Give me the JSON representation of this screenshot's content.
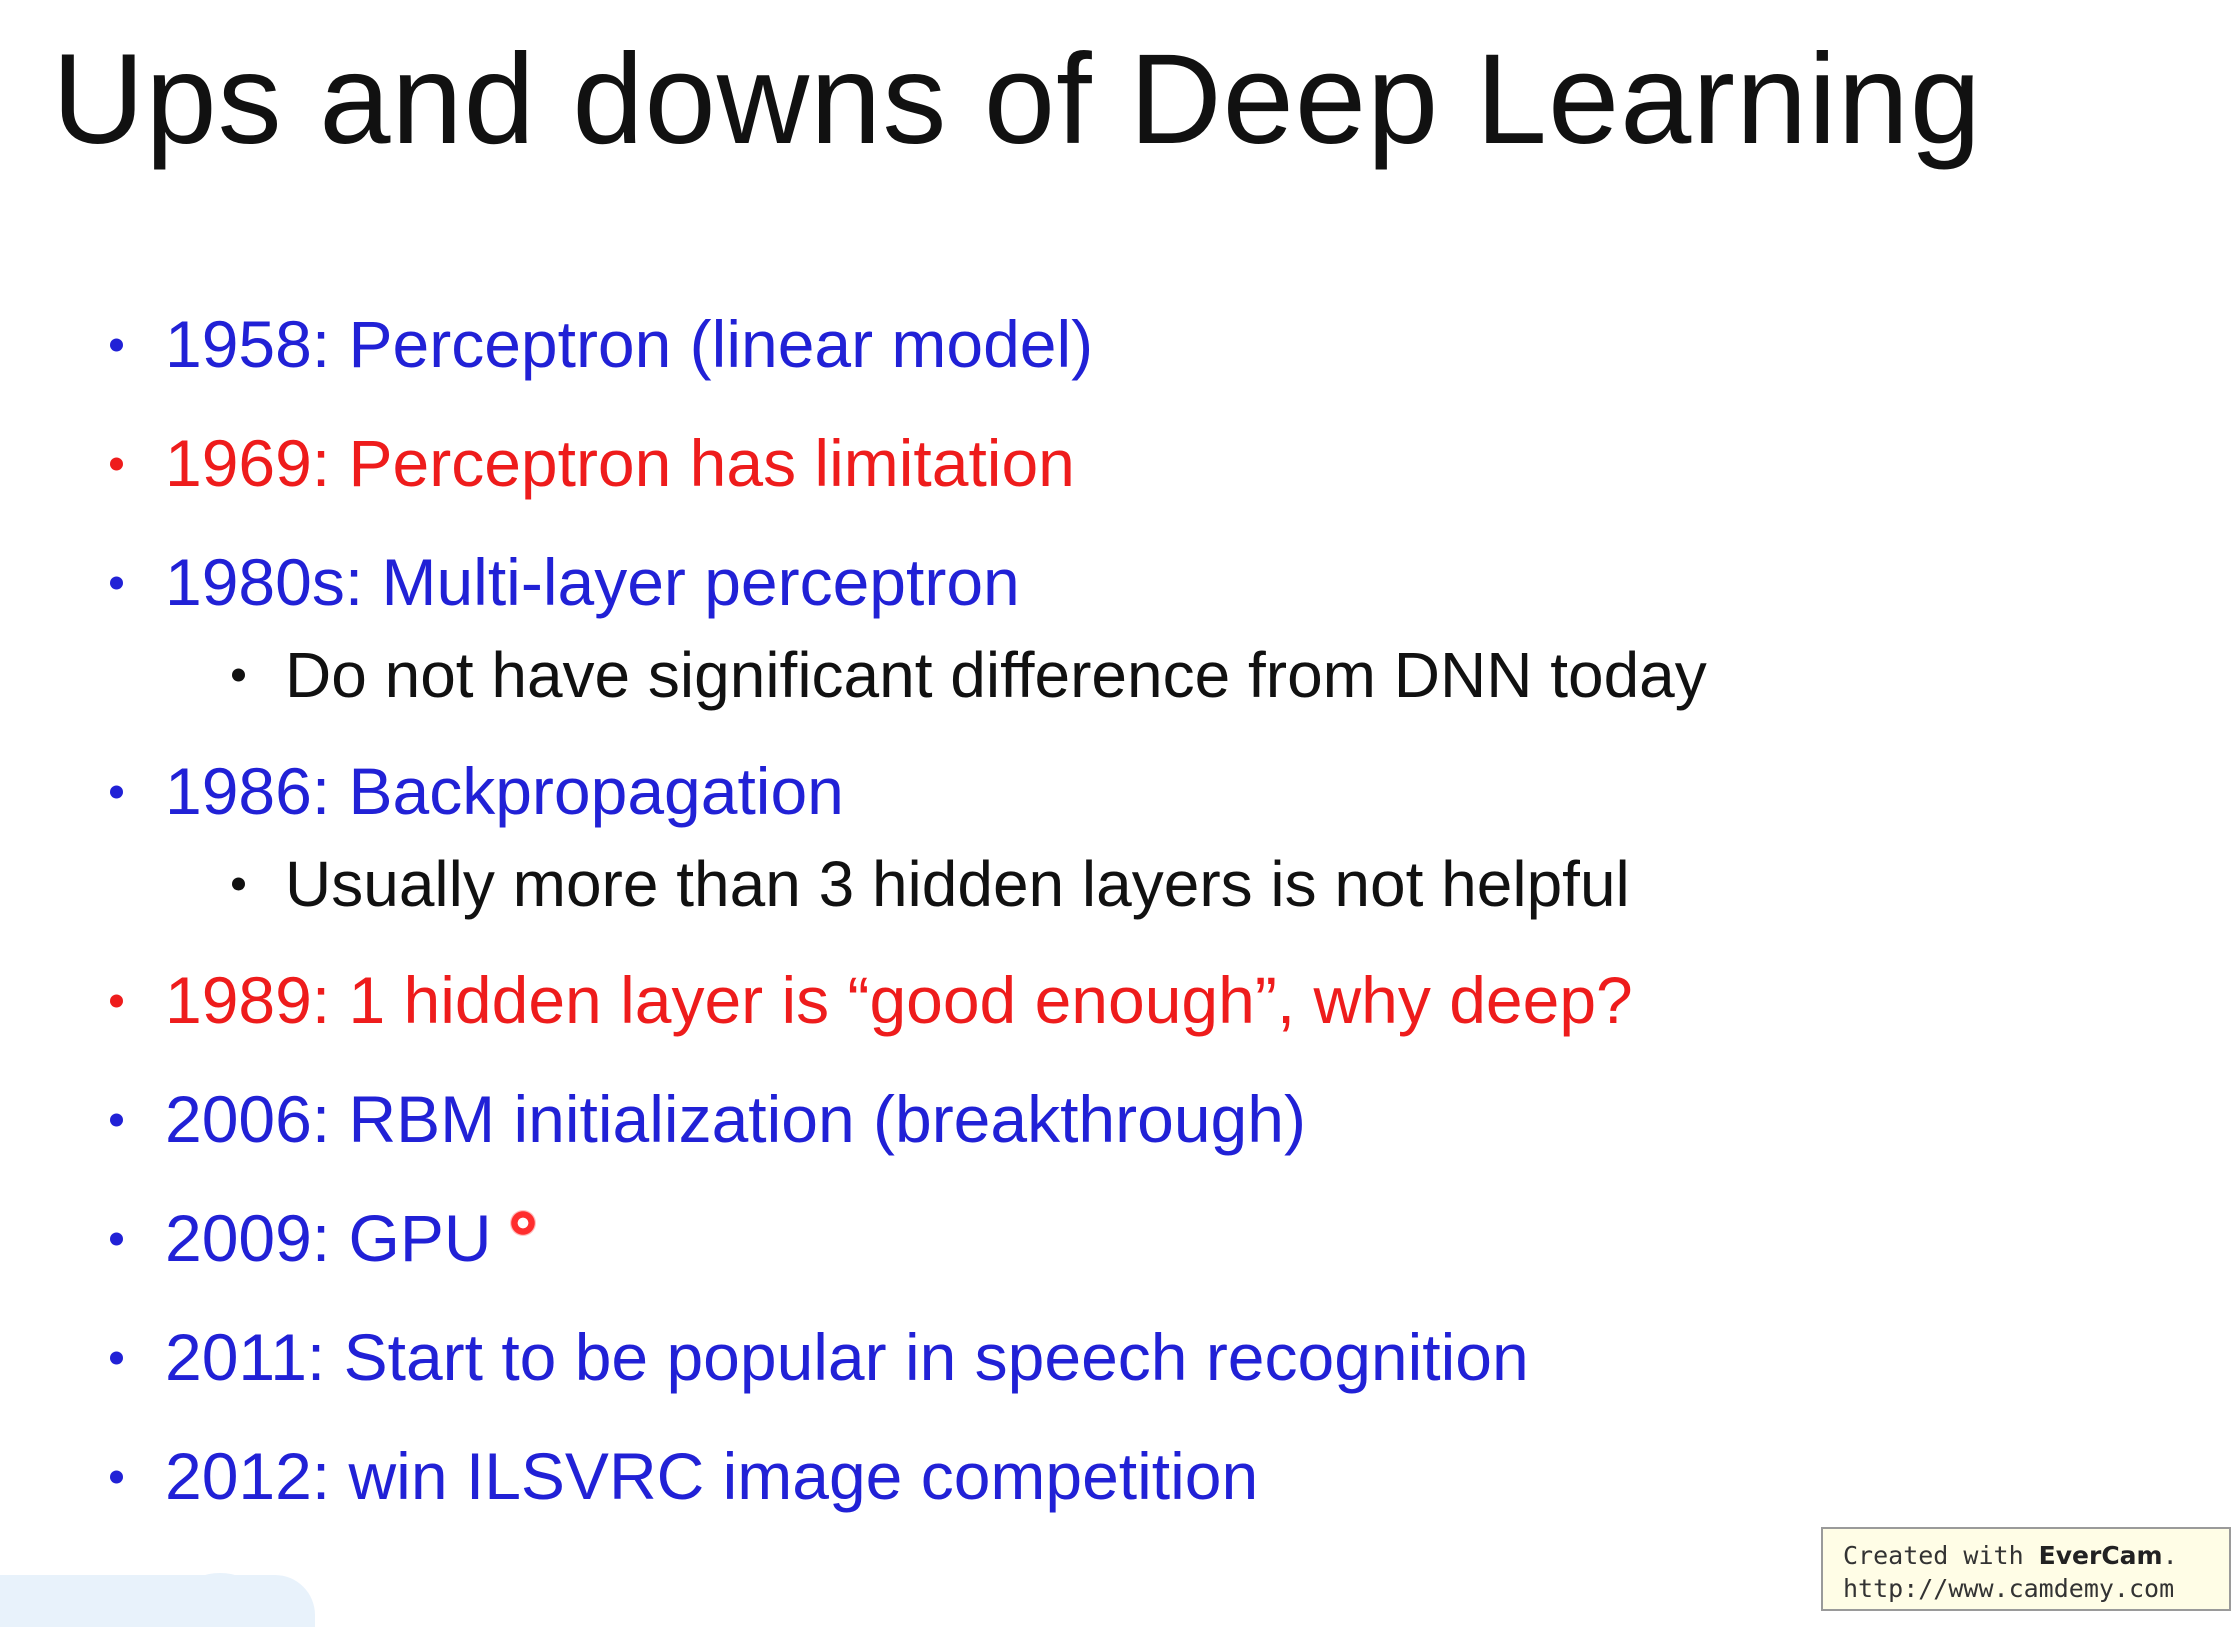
{
  "title": "Ups and downs of Deep Learning",
  "colors": {
    "blue": "#2121d6",
    "red": "#ee1c1c",
    "black": "#111111"
  },
  "bullets": [
    {
      "text": "1958: Perceptron (linear model)",
      "color": "blue"
    },
    {
      "text": "1969: Perceptron has limitation",
      "color": "red"
    },
    {
      "text": "1980s: Multi-layer perceptron",
      "color": "blue"
    },
    {
      "text": "Do not have significant difference from DNN today",
      "color": "black"
    },
    {
      "text": "1986: Backpropagation",
      "color": "blue"
    },
    {
      "text": "Usually more than 3 hidden layers is not helpful",
      "color": "black"
    },
    {
      "text": "1989: 1 hidden layer is “good enough”, why deep?",
      "color": "red"
    },
    {
      "text": "2006: RBM initialization (breakthrough)",
      "color": "blue"
    },
    {
      "text": "2009: GPU",
      "color": "blue"
    },
    {
      "text": "2011: Start to be popular in speech recognition",
      "color": "blue"
    },
    {
      "text": "2012: win ILSVRC image competition",
      "color": "blue"
    }
  ],
  "watermark": {
    "prefix": "Created with ",
    "brand": "EverCam",
    "suffix": ".",
    "url": "http://www.camdemy.com"
  }
}
